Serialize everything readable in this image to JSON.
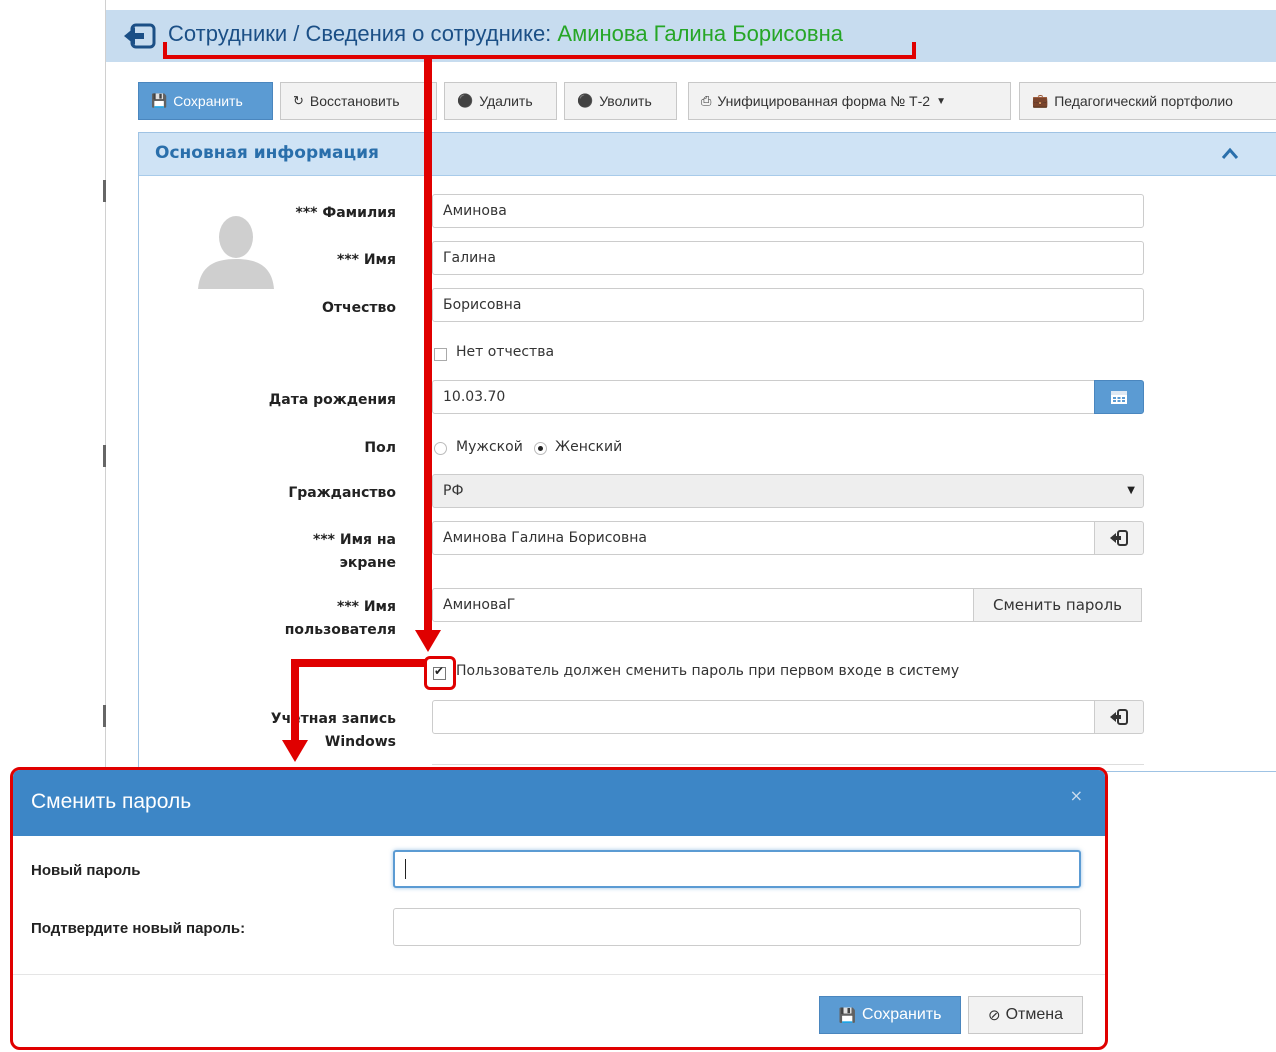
{
  "header": {
    "breadcrumb": "Сотрудники / Сведения о сотруднике: ",
    "employee_name": "Аминова Галина Борисовна"
  },
  "toolbar": {
    "save": "Сохранить",
    "restore": "Восстановить",
    "delete": "Удалить",
    "dismiss": "Уволить",
    "form_t2": "Унифицированная форма № Т-2",
    "portfolio": "Педагогический портфолио"
  },
  "panel": {
    "title": "Основная информация"
  },
  "form": {
    "surname_label": "*** Фамилия",
    "surname_value": "Аминова",
    "name_label": "*** Имя",
    "name_value": "Галина",
    "patronymic_label": "Отчество",
    "patronymic_value": "Борисовна",
    "no_patronymic": "Нет отчества",
    "no_patronymic_checked": false,
    "birthdate_label": "Дата рождения",
    "birthdate_value": "10.03.70",
    "gender_label": "Пол",
    "gender_male": "Мужской",
    "gender_female": "Женский",
    "gender_selected": "Женский",
    "citizenship_label": "Гражданство",
    "citizenship_value": "РФ",
    "display_name_label_1": "*** Имя на",
    "display_name_label_2": "экране",
    "display_name_value": "Аминова Галина Борисовна",
    "username_label_1": "*** Имя",
    "username_label_2": "пользователя",
    "username_value": "АминоваГ",
    "change_password_button": "Сменить пароль",
    "must_change_password": "Пользователь должен сменить пароль при первом входе в систему",
    "must_change_password_checked": true,
    "windows_label_1": "Учетная запись",
    "windows_label_2": "Windows",
    "windows_value": ""
  },
  "modal": {
    "title": "Сменить пароль",
    "close": "×",
    "new_password_label": "Новый пароль",
    "new_password_value": "",
    "confirm_label": "Подтвердите новый пароль:",
    "confirm_value": "",
    "save": "Сохранить",
    "cancel": "Отмена"
  },
  "colors": {
    "header_bg": "#c7dcef",
    "primary": "#5b9bd3",
    "modal_head": "#3d86c6",
    "annotation": "#e00000",
    "name_green": "#26a626"
  },
  "icons": [
    "back-icon",
    "save-icon",
    "refresh-icon",
    "minus-circle-icon",
    "printer-icon",
    "briefcase-icon",
    "chevron-up-icon",
    "user-avatar-icon",
    "calendar-icon",
    "login-icon",
    "ban-icon"
  ]
}
